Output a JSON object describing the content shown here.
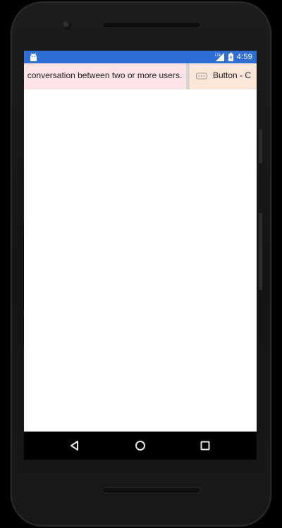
{
  "status_bar": {
    "time": "4:59",
    "app_icon": "android-icon",
    "signal_icon": "signal-icon",
    "battery_icon": "battery-icon",
    "color": "#2f6fd3"
  },
  "list_row": {
    "items": [
      {
        "text": "conversation between two or more users.",
        "background": "#fbe3e6"
      },
      {
        "icon": "button-icon",
        "text": "Button - C",
        "background": "#fbe7d9"
      }
    ]
  },
  "navbar": {
    "back_icon": "back-icon",
    "home_icon": "home-icon",
    "recents_icon": "recents-icon"
  }
}
